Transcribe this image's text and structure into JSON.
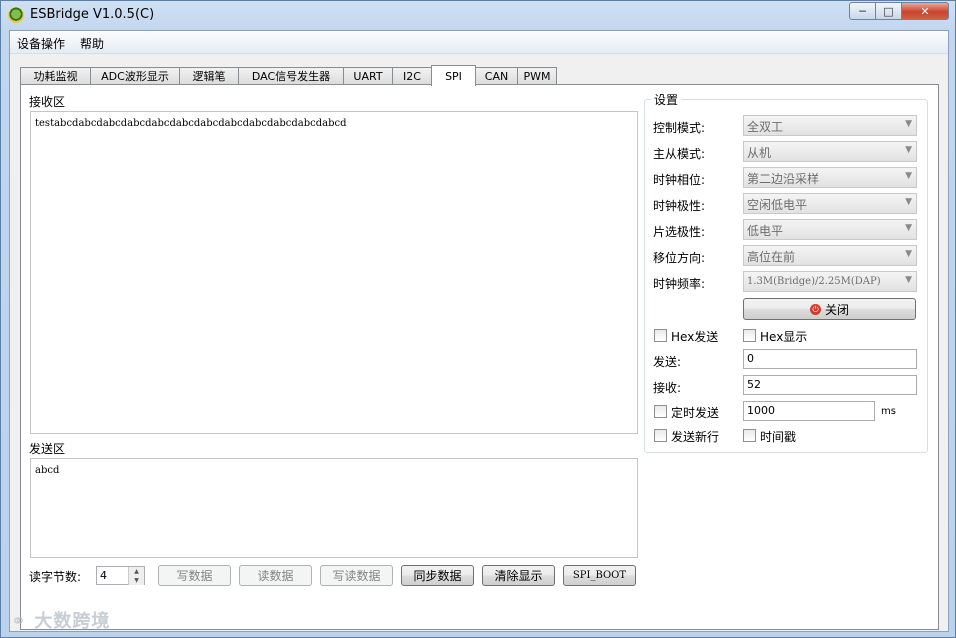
{
  "window": {
    "title": "ESBridge V1.0.5(C)"
  },
  "menu": [
    "设备操作",
    "帮助"
  ],
  "tabs": [
    "功耗监视",
    "ADC波形显示",
    "逻辑笔",
    "DAC信号发生器",
    "UART",
    "I2C",
    "SPI",
    "CAN",
    "PWM"
  ],
  "active_tab": "SPI",
  "receive": {
    "label": "接收区",
    "text": "testabcdabcdabcdabcdabcdabcdabcdabcdabcdabcdabcdabcd"
  },
  "send": {
    "label": "发送区",
    "text": "abcd"
  },
  "bottom": {
    "read_bytes_label": "读字节数:",
    "read_bytes_value": "4",
    "buttons": [
      "写数据",
      "读数据",
      "写读数据",
      "同步数据",
      "清除显示",
      "SPI_BOOT"
    ]
  },
  "settings": {
    "title": "设置",
    "rows": [
      {
        "label": "控制模式:",
        "value": "全双工"
      },
      {
        "label": "主从模式:",
        "value": "从机"
      },
      {
        "label": "时钟相位:",
        "value": "第二边沿采样"
      },
      {
        "label": "时钟极性:",
        "value": "空闲低电平"
      },
      {
        "label": "片选极性:",
        "value": "低电平"
      },
      {
        "label": "移位方向:",
        "value": "高位在前"
      },
      {
        "label": "时钟频率:",
        "value": "1.3M(Bridge)/2.25M(DAP)"
      }
    ],
    "close_button": "关闭",
    "hex_send": "Hex发送",
    "hex_show": "Hex显示",
    "sent_label": "发送:",
    "sent_value": "0",
    "recv_label": "接收:",
    "recv_value": "52",
    "timed_send": "定时发送",
    "timed_value": "1000",
    "timed_unit": "ms",
    "send_newline": "发送新行",
    "timestamp": "时间戳"
  },
  "watermark": "大数跨境",
  "accent_colors": {
    "power": "#d33a2b",
    "close_btn": "#c8442d"
  }
}
